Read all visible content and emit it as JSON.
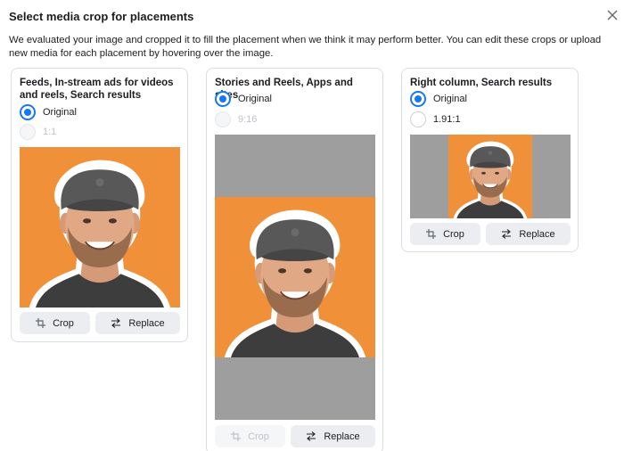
{
  "dialog": {
    "title": "Select media crop for placements",
    "description": "We evaluated your image and cropped it to fill the placement when we think it may perform better. You can edit these crops or upload new media for each placement by hovering over the image.",
    "close_icon": "close-icon"
  },
  "cards": [
    {
      "title": "Feeds, In-stream ads for videos and reels, Search results",
      "options": [
        {
          "label": "Original",
          "selected": true,
          "disabled": false
        },
        {
          "label": "1:1",
          "selected": false,
          "disabled": true
        }
      ],
      "crop_label": "Crop",
      "replace_label": "Replace"
    },
    {
      "title": "Stories and Reels, Apps and sites",
      "options": [
        {
          "label": "Original",
          "selected": true,
          "disabled": false
        },
        {
          "label": "9:16",
          "selected": false,
          "disabled": true
        }
      ],
      "crop_label": "Crop",
      "replace_label": "Replace"
    },
    {
      "title": "Right column, Search results",
      "options": [
        {
          "label": "Original",
          "selected": true,
          "disabled": false
        },
        {
          "label": "1.91:1",
          "selected": false,
          "disabled": false
        }
      ],
      "crop_label": "Crop",
      "replace_label": "Replace"
    }
  ],
  "colors": {
    "accent": "#1877f2",
    "image_background": "#f0913a",
    "letterbox": "#9e9e9e"
  }
}
